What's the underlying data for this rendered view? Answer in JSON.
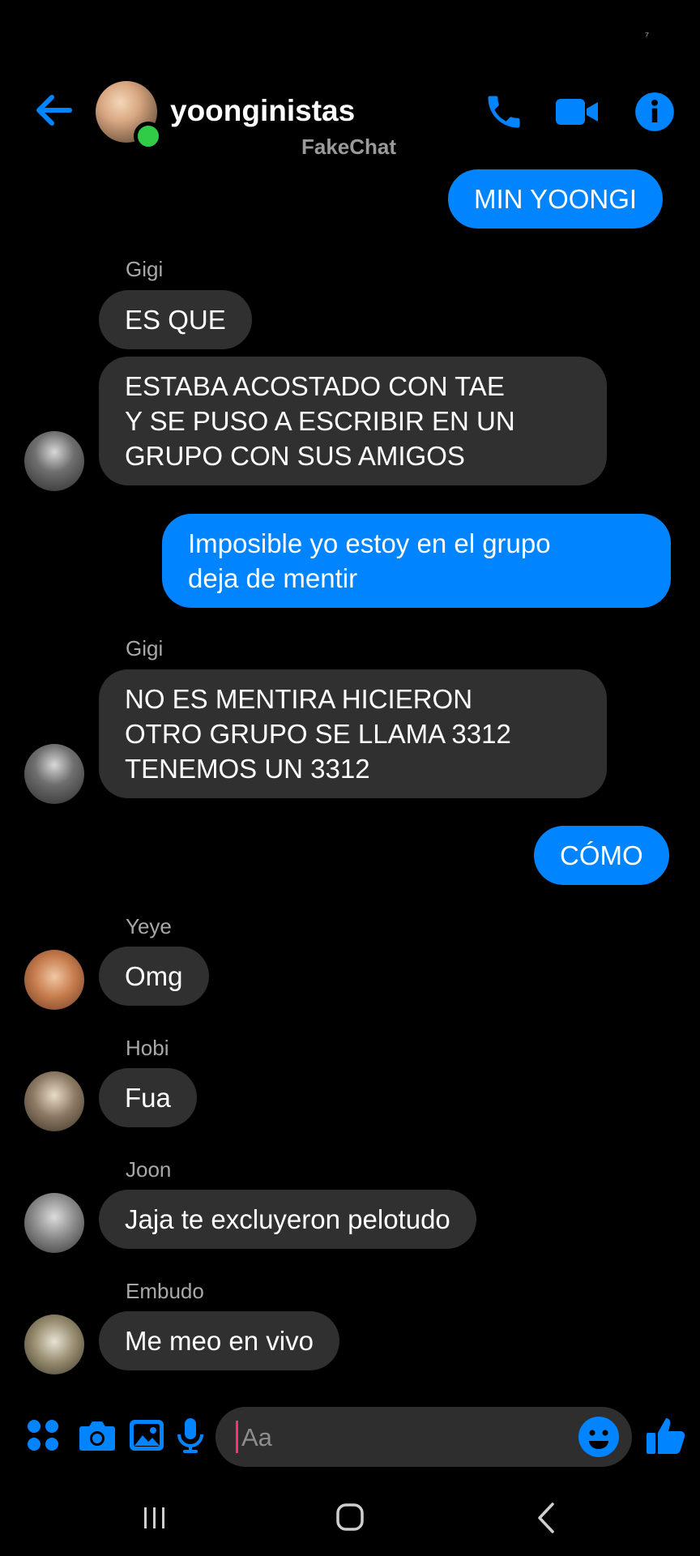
{
  "status_bar": {
    "mark": "⁷"
  },
  "header": {
    "title": "yoonginistas",
    "subtitle": "FakeChat",
    "icons": [
      "back-arrow-icon",
      "phone-icon",
      "video-camera-icon",
      "info-icon"
    ]
  },
  "colors": {
    "accent": "#0084ff",
    "incoming_bubble": "#303030",
    "online": "#31cc46",
    "background": "#000000"
  },
  "messages": [
    {
      "direction": "out",
      "text": "MIN YOONGI"
    },
    {
      "direction": "in",
      "sender": "Gigi",
      "text": "ES QUE"
    },
    {
      "direction": "in",
      "text": "ESTABA ACOSTADO CON TAE\nY SE PUSO A ESCRIBIR EN UN\nGRUPO CON SUS AMIGOS"
    },
    {
      "direction": "out",
      "text": "Imposible yo estoy en el grupo\ndeja de mentir"
    },
    {
      "direction": "in",
      "sender": "Gigi",
      "text": "NO ES MENTIRA HICIERON\nOTRO GRUPO SE LLAMA 3312\nTENEMOS UN 3312"
    },
    {
      "direction": "out",
      "text": "CÓMO"
    },
    {
      "direction": "in",
      "sender": "Yeye",
      "text": "Omg"
    },
    {
      "direction": "in",
      "sender": "Hobi",
      "text": "Fua"
    },
    {
      "direction": "in",
      "sender": "Joon",
      "text": "Jaja te excluyeron pelotudo"
    },
    {
      "direction": "in",
      "sender": "Embudo",
      "text": "Me meo en vivo"
    }
  ],
  "composer": {
    "placeholder": "Aa",
    "icons": [
      "apps-icon",
      "camera-icon",
      "image-icon",
      "microphone-icon",
      "emoji-icon",
      "thumbs-up-icon"
    ]
  },
  "nav": {
    "icons": [
      "recents-icon",
      "home-icon",
      "back-icon"
    ]
  }
}
